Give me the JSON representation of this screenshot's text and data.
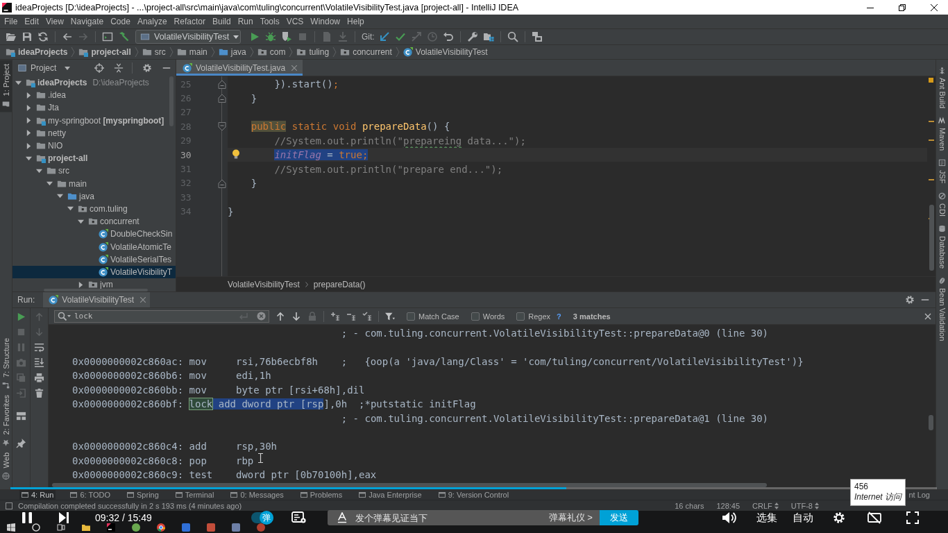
{
  "window": {
    "title": "ideaProjects [D:\\ideaProjects] - ...\\project-all\\src\\main\\java\\com\\tuling\\concurrent\\VolatileVisibilityTest.java [project-all] - IntelliJ IDEA"
  },
  "menu": [
    "File",
    "Edit",
    "View",
    "Navigate",
    "Code",
    "Analyze",
    "Refactor",
    "Build",
    "Run",
    "Tools",
    "VCS",
    "Window",
    "Help"
  ],
  "toolbar": {
    "run_config": "VolatileVisibilityTest",
    "vcs_label": "Git:"
  },
  "navigation": [
    {
      "label": "ideaProjects",
      "kind": "module",
      "bold": true
    },
    {
      "label": "project-all",
      "kind": "module",
      "bold": true
    },
    {
      "label": "src",
      "kind": "folder",
      "bold": false
    },
    {
      "label": "main",
      "kind": "folder",
      "bold": false
    },
    {
      "label": "java",
      "kind": "source",
      "bold": false
    },
    {
      "label": "com",
      "kind": "package",
      "bold": false
    },
    {
      "label": "tuling",
      "kind": "package",
      "bold": false
    },
    {
      "label": "concurrent",
      "kind": "package",
      "bold": false
    },
    {
      "label": "VolatileVisibilityTest",
      "kind": "class",
      "bold": false
    }
  ],
  "left_stripe": {
    "top": [
      {
        "label": "1: Project",
        "kind": "project",
        "selected": true
      }
    ],
    "bottom": [
      {
        "label": "7: Structure",
        "kind": "structure",
        "selected": false
      },
      {
        "label": "2: Favorites",
        "kind": "favorites",
        "selected": false
      },
      {
        "label": "Web",
        "kind": "web",
        "selected": false
      }
    ]
  },
  "right_stripe": [
    {
      "label": "Ant Build",
      "kind": "ant"
    },
    {
      "label": "Maven",
      "kind": "maven"
    },
    {
      "label": "JSF",
      "kind": "jsf"
    },
    {
      "label": "CDI",
      "kind": "cdi"
    },
    {
      "label": "Database",
      "kind": "database"
    },
    {
      "label": "Bean Validation",
      "kind": "bean"
    }
  ],
  "project": {
    "title": "Project",
    "tree": [
      {
        "label": "ideaProjects",
        "detail": "D:\\ideaProjects",
        "kind": "module",
        "bold": true,
        "expanded": true,
        "selected": false,
        "children": [
          {
            "label": ".idea",
            "kind": "folder",
            "bold": false,
            "expanded": false,
            "selected": false
          },
          {
            "label": "Jta",
            "kind": "folder",
            "bold": false,
            "expanded": false,
            "selected": false
          },
          {
            "label": "my-springboot **[myspringboot]**",
            "kind": "module",
            "bold": false,
            "expanded": false,
            "selected": false
          },
          {
            "label": "netty",
            "kind": "folder",
            "bold": false,
            "expanded": false,
            "selected": false
          },
          {
            "label": "NIO",
            "kind": "folder",
            "bold": false,
            "expanded": false,
            "selected": false
          },
          {
            "label": "project-all",
            "kind": "module",
            "bold": true,
            "expanded": true,
            "selected": false,
            "children": [
              {
                "label": "src",
                "kind": "folder",
                "bold": false,
                "expanded": true,
                "selected": false,
                "children": [
                  {
                    "label": "main",
                    "kind": "folder",
                    "bold": false,
                    "expanded": true,
                    "selected": false,
                    "children": [
                      {
                        "label": "java",
                        "kind": "source",
                        "bold": false,
                        "expanded": true,
                        "selected": false,
                        "children": [
                          {
                            "label": "com.tuling",
                            "kind": "package",
                            "bold": false,
                            "expanded": true,
                            "selected": false,
                            "children": [
                              {
                                "label": "concurrent",
                                "kind": "package",
                                "bold": false,
                                "expanded": true,
                                "selected": false,
                                "children": [
                                  {
                                    "label": "DoubleCheckSin",
                                    "kind": "class",
                                    "bold": false,
                                    "selected": false
                                  },
                                  {
                                    "label": "VolatileAtomicTe",
                                    "kind": "class",
                                    "bold": false,
                                    "selected": false
                                  },
                                  {
                                    "label": "VolatileSerialTes",
                                    "kind": "class",
                                    "bold": false,
                                    "selected": false
                                  },
                                  {
                                    "label": "VolatileVisibilityT",
                                    "kind": "class",
                                    "bold": false,
                                    "selected": true
                                  }
                                ]
                              },
                              {
                                "label": "jvm",
                                "kind": "package",
                                "bold": false,
                                "expanded": false,
                                "selected": false
                              }
                            ]
                          }
                        ]
                      }
                    ]
                  }
                ]
              }
            ]
          }
        ]
      }
    ]
  },
  "editor": {
    "tab": {
      "label": "VolatileVisibilityTest.java",
      "selected": true
    },
    "lines": [
      {
        "number": "25",
        "fold": {
          "kind": "end"
        },
        "current": false,
        "intention": false,
        "tokens": [
          {
            "text": "        }).start()",
            "kind": "plain"
          },
          {
            "text": ";",
            "kind": "keyword"
          }
        ]
      },
      {
        "number": "26",
        "fold": {
          "kind": "end"
        },
        "current": false,
        "intention": false,
        "tokens": [
          {
            "text": "    }",
            "kind": "plain"
          }
        ]
      },
      {
        "number": "27",
        "current": false,
        "intention": false
      },
      {
        "number": "28",
        "fold": {
          "kind": "start"
        },
        "current": false,
        "intention": false,
        "tokens": [
          {
            "text": "    public",
            "kind": "keyword",
            "marked": true
          },
          {
            "text": " static void ",
            "kind": "keyword"
          },
          {
            "text": "prepareData",
            "kind": "method"
          },
          {
            "text": "() {",
            "kind": "plain"
          }
        ]
      },
      {
        "number": "29",
        "current": false,
        "intention": false,
        "tokens": [
          {
            "text": "        //System.out.println(\"",
            "kind": "comment"
          },
          {
            "text": "prepareing",
            "kind": "comment",
            "typo": true
          },
          {
            "text": " data...\");",
            "kind": "comment"
          }
        ]
      },
      {
        "number": "30",
        "current": true,
        "intention": true,
        "tokens": [
          {
            "text": "        initFlag",
            "kind": "static-field",
            "selected": true
          },
          {
            "text": " = ",
            "kind": "plain",
            "selected": true
          },
          {
            "text": "true",
            "kind": "keyword",
            "selected": true
          },
          {
            "text": ";",
            "kind": "keyword",
            "selected": true
          }
        ]
      },
      {
        "number": "31",
        "current": false,
        "intention": false,
        "tokens": [
          {
            "text": "        //System.out.println(\"prepare end...\");",
            "kind": "comment"
          }
        ]
      },
      {
        "number": "32",
        "fold": {
          "kind": "end"
        },
        "current": false,
        "intention": false,
        "tokens": [
          {
            "text": "    }",
            "kind": "plain"
          }
        ]
      },
      {
        "number": "33",
        "current": false,
        "intention": false
      },
      {
        "number": "34",
        "current": false,
        "intention": false,
        "tokens": [
          {
            "text": "}",
            "kind": "plain"
          }
        ]
      }
    ],
    "path": [
      "VolatileVisibilityTest",
      "prepareData()"
    ]
  },
  "run": {
    "title": "Run:",
    "tab": {
      "label": "VolatileVisibilityTest",
      "selected": true
    },
    "search": {
      "value": "lock",
      "options": [
        {
          "label": "Match Case",
          "checked": false
        },
        {
          "label": "Words",
          "checked": false
        },
        {
          "label": "Regex",
          "checked": false
        }
      ],
      "help": "?",
      "matches": "3 matches"
    },
    "output": [
      {
        "lines": [
          {
            "tokens": [
              {
                "text": "                                              ; - com.tuling.concurrent.VolatileVisibilityTest::prepareData@0 (line 30)",
                "kind": "plain"
              }
            ]
          }
        ]
      },
      {
        "lines": [
          {
            "tokens": [
              {
                "text": "0x0000000002c860ac: mov     rsi,76b6ecbf8h    ;   {oop(a 'java/lang/Class' = 'com/tuling/concurrent/VolatileVisibilityTest')}",
                "kind": "plain"
              }
            ]
          },
          {
            "tokens": [
              {
                "text": "0x0000000002c860b6: mov     edi,1h",
                "kind": "plain"
              }
            ]
          },
          {
            "tokens": [
              {
                "text": "0x0000000002c860bb: mov     byte ptr [rsi+68h],dil",
                "kind": "plain"
              }
            ]
          },
          {
            "tokens": [
              {
                "text": "0x0000000002c860bf: ",
                "kind": "plain"
              },
              {
                "text": "lock",
                "kind": "match"
              },
              {
                "text": " add dword ptr [rsp",
                "kind": "selection"
              },
              {
                "text": "],0h  ;*putstatic initFlag",
                "kind": "plain"
              }
            ]
          },
          {
            "tokens": [
              {
                "text": "                                              ; - com.tuling.concurrent.VolatileVisibilityTest::prepareData@1 (line 30)",
                "kind": "plain"
              }
            ]
          }
        ]
      },
      {
        "lines": [
          {
            "tokens": [
              {
                "text": "0x0000000002c860c4: add     rsp,30h",
                "kind": "plain"
              }
            ]
          },
          {
            "tokens": [
              {
                "text": "0x0000000002c860c8: pop     rbp",
                "kind": "plain"
              }
            ]
          },
          {
            "tokens": [
              {
                "text": "0x0000000002c860c9: test    dword ptr [0b70100h],eax",
                "kind": "plain"
              }
            ]
          }
        ]
      }
    ]
  },
  "tool_windows": {
    "items": [
      {
        "label": "4: Run",
        "selected": true
      },
      {
        "label": "6: TODO",
        "selected": false
      },
      {
        "label": "Spring",
        "selected": false
      },
      {
        "label": "Terminal",
        "selected": false
      },
      {
        "label": "0: Messages",
        "selected": false
      },
      {
        "label": "Problems",
        "selected": false
      },
      {
        "label": "Java Enterprise",
        "selected": false
      },
      {
        "label": "9: Version Control",
        "selected": false
      }
    ],
    "right": "nt Log"
  },
  "status_bar": {
    "message": "Compilation completed successfully in 2 s 193 ms (4 minutes ago)",
    "items": [
      {
        "label": "16 chars",
        "kind": "text"
      },
      {
        "label": "128:45",
        "kind": "text"
      },
      {
        "label": "CRLF",
        "kind": "menu"
      },
      {
        "label": "UTF-8",
        "kind": "menu"
      }
    ]
  },
  "player": {
    "playing": true,
    "progress": {
      "level": 0.6
    },
    "time": "09:32 / 15:49",
    "danmaku": {
      "on": true,
      "toggle_label": "弹",
      "placeholder": "发个弹幕见证当下",
      "etiquette": "弹幕礼仪 >",
      "send": "发送"
    },
    "episodes": "选集",
    "autoplay": "自动"
  },
  "tooltip": {
    "title": "456",
    "text": "Internet 访问"
  }
}
